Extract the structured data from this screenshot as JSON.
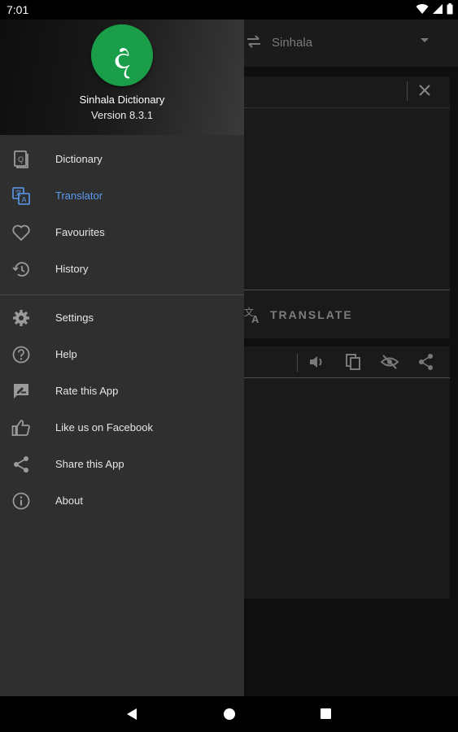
{
  "status_bar": {
    "time": "7:01"
  },
  "app": {
    "target_language": "Sinhala",
    "translate_label": "TRANSLATE"
  },
  "drawer": {
    "app_name": "Sinhala Dictionary",
    "version": "Version 8.3.1",
    "logo_glyph": "ද",
    "logo_color": "#1a9e4a",
    "active_color": "#5b9bf2",
    "primary_items": [
      {
        "label": "Dictionary",
        "icon": "dictionary-book-icon"
      },
      {
        "label": "Translator",
        "icon": "translate-icon",
        "active": true
      },
      {
        "label": "Favourites",
        "icon": "heart-icon"
      },
      {
        "label": "History",
        "icon": "history-icon"
      }
    ],
    "secondary_items": [
      {
        "label": "Settings",
        "icon": "gear-icon"
      },
      {
        "label": "Help",
        "icon": "help-icon"
      },
      {
        "label": "Rate this App",
        "icon": "rate-icon"
      },
      {
        "label": "Like us on Facebook",
        "icon": "thumbs-up-icon"
      },
      {
        "label": "Share this App",
        "icon": "share-icon"
      },
      {
        "label": "About",
        "icon": "info-icon"
      }
    ]
  }
}
